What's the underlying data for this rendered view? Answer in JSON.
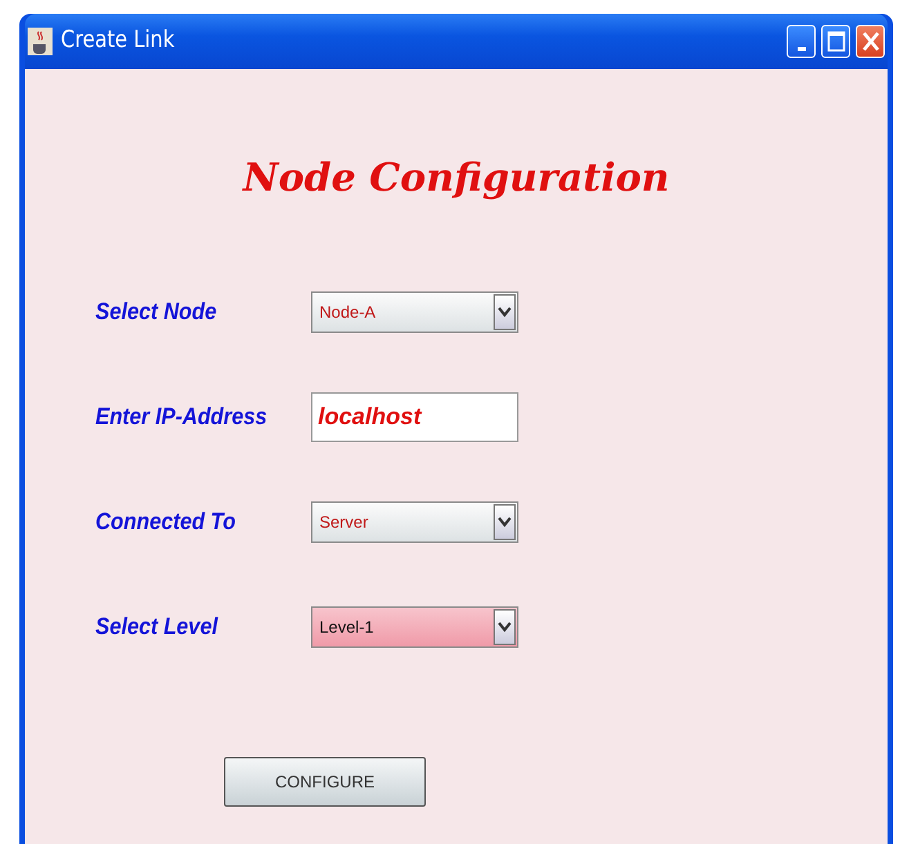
{
  "window": {
    "title": "Create Link"
  },
  "heading": "Node Configuration",
  "fields": [
    {
      "label": "Select Node",
      "kind": "combo",
      "value": "Node-A",
      "highlighted": false
    },
    {
      "label": "Enter IP-Address",
      "kind": "text",
      "value": "localhost",
      "highlighted": false
    },
    {
      "label": "Connected To",
      "kind": "combo",
      "value": "Server",
      "highlighted": false
    },
    {
      "label": "Select Level",
      "kind": "combo",
      "value": "Level-1",
      "highlighted": true
    }
  ],
  "button": "CONFIGURE"
}
